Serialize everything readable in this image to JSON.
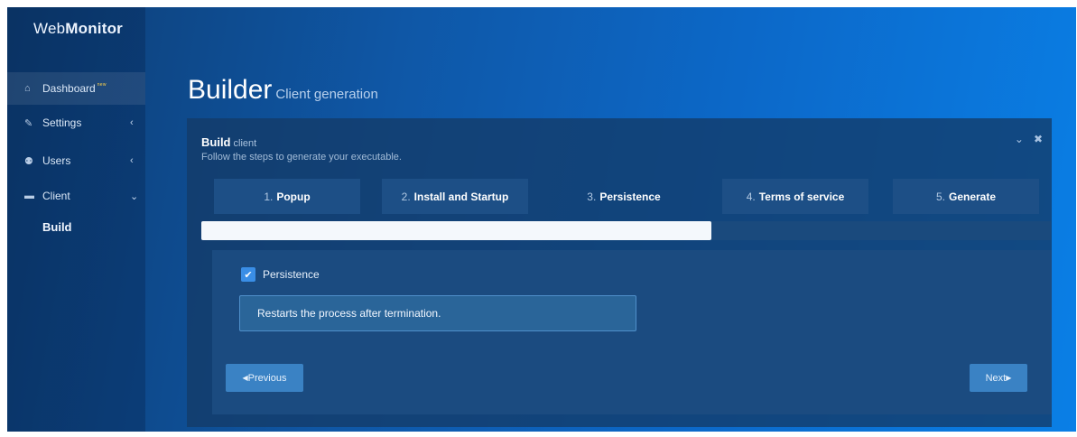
{
  "brand": {
    "prefix": "Web",
    "bold": "Monitor"
  },
  "sidebar": {
    "items": [
      {
        "label": "Dashboard",
        "badge": "new",
        "icon": "home-icon",
        "glyph": "⌂"
      },
      {
        "label": "Settings",
        "icon": "pencil-icon",
        "glyph": "✎",
        "chevron": "‹"
      },
      {
        "label": "Users",
        "icon": "users-icon",
        "glyph": "⚉",
        "chevron": "‹"
      },
      {
        "label": "Client",
        "icon": "folder-icon",
        "glyph": "▬",
        "chevron": "⌄"
      }
    ],
    "sub_item": "Build"
  },
  "page": {
    "title": "Builder",
    "subtitle": "Client generation"
  },
  "panel": {
    "title": "Build",
    "title_light": "client",
    "description": "Follow the steps to generate your executable.",
    "tools": {
      "collapse": "⌄",
      "close": "✖"
    }
  },
  "steps": [
    {
      "num": "1.",
      "label": "Popup"
    },
    {
      "num": "2.",
      "label": "Install and Startup"
    },
    {
      "num": "3.",
      "label": "Persistence"
    },
    {
      "num": "4.",
      "label": "Terms of service"
    },
    {
      "num": "5.",
      "label": "Generate"
    }
  ],
  "progress": {
    "percent": 60
  },
  "persistence": {
    "checkbox_label": "Persistence",
    "checked": true,
    "info": "Restarts the process after termination."
  },
  "buttons": {
    "previous": "Previous",
    "next": "Next"
  },
  "colors": {
    "accent": "#3a82c4",
    "checkbox": "#3a8ee6"
  }
}
